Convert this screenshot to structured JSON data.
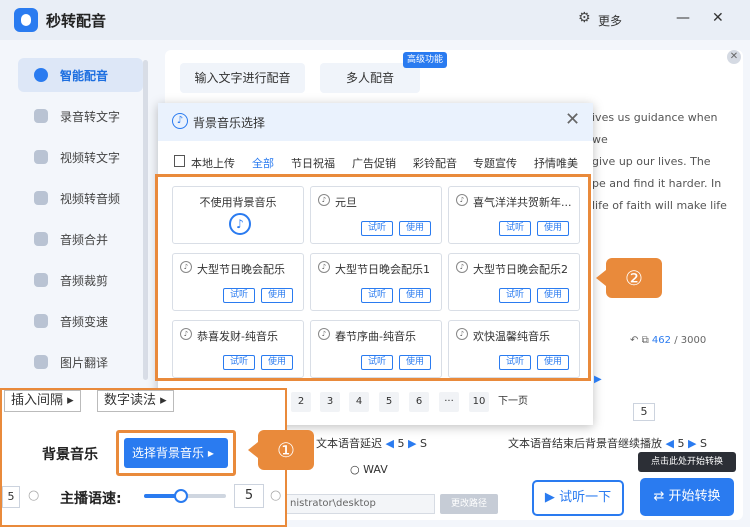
{
  "app": {
    "title": "秒转配音",
    "more_label": "更多"
  },
  "sidebar": {
    "items": [
      {
        "label": "智能配音",
        "active": true
      },
      {
        "label": "录音转文字"
      },
      {
        "label": "视频转文字"
      },
      {
        "label": "视频转音频"
      },
      {
        "label": "音频合并"
      },
      {
        "label": "音频裁剪"
      },
      {
        "label": "音频变速"
      },
      {
        "label": "图片翻译"
      }
    ]
  },
  "tabs": {
    "text_input": "输入文字进行配音",
    "multi_voice": "多人配音",
    "advanced_badge": "高级功能"
  },
  "editor": {
    "text_lines": [
      "ives us guidance when we",
      "give up our lives. The",
      "pe and find it harder. In",
      "life of faith will make life"
    ],
    "char_count": "462",
    "char_limit": "/ 3000"
  },
  "settings": {
    "tts_delay_label": "文本语音延迟",
    "tts_delay_value": "5",
    "tts_delay_unit": "S",
    "bgm_after_label": "文本语音结束后背景音继续播放",
    "bgm_after_value": "5",
    "bgm_after_unit": "S",
    "pause_value": "5",
    "format_wav": "WAV",
    "path_value": "nistrator\\desktop",
    "change_path": "更改路径"
  },
  "actions": {
    "listen": "试听一下",
    "convert": "开始转换",
    "convert_tooltip": "点击此处开始转换"
  },
  "inset": {
    "insert_pause": "插入间隔 ▸",
    "number_read": "数字读法 ▸",
    "bgm_label": "背景音乐",
    "select_bgm_button": "选择背景音乐 ▸",
    "speed_label": "主播语速:",
    "speed_value": "5",
    "left_value": "5",
    "speed_level": 0.45
  },
  "markers": {
    "m1": "①",
    "m2": "②"
  },
  "modal": {
    "title": "背景音乐选择",
    "upload_label": "本地上传",
    "categories": [
      "全部",
      "节日祝福",
      "广告促销",
      "彩铃配音",
      "专题宣传",
      "抒情唯美"
    ],
    "no_music_label": "不使用背景音乐",
    "listen_label": "试听",
    "use_label": "使用",
    "tracks": [
      "元旦",
      "喜气洋洋共贺新年...",
      "大型节日晚会配乐",
      "大型节日晚会配乐1",
      "大型节日晚会配乐2",
      "恭喜发财-纯音乐",
      "春节序曲-纯音乐",
      "欢快温馨纯音乐"
    ],
    "pagination": [
      "2",
      "3",
      "4",
      "5",
      "6",
      "···",
      "10",
      "下一页"
    ]
  }
}
